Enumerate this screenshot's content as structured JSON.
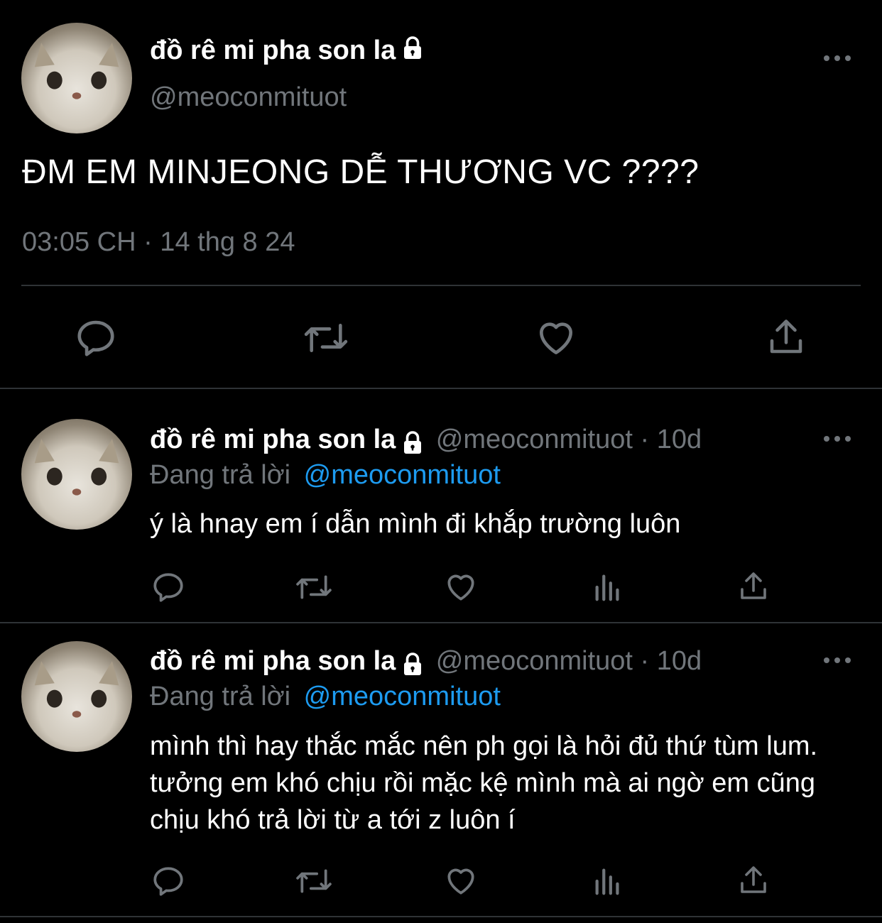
{
  "main_tweet": {
    "display_name": "đồ rê mi pha son la",
    "handle": "@meoconmituot",
    "text": "ĐM EM MINJEONG DỄ THƯƠNG VC ????",
    "timestamp": "03:05 CH · 14 thg 8 24"
  },
  "replies": [
    {
      "display_name": "đồ rê mi pha son la",
      "meta": "@meoconmituot · 10d",
      "replying_prefix": "Đang trả lời",
      "replying_to": "@meoconmituot",
      "text": "ý là hnay em í dẫn mình đi khắp trường luôn"
    },
    {
      "display_name": "đồ rê mi pha son la",
      "meta": "@meoconmituot · 10d",
      "replying_prefix": "Đang trả lời",
      "replying_to": "@meoconmituot",
      "text": "mình thì hay thắc mắc nên ph gọi là hỏi đủ thứ tùm lum. tưởng em khó chịu rồi mặc kệ mình mà ai ngờ em cũng chịu khó trả lời từ a tới z luôn í"
    }
  ],
  "icons": [
    "lock-icon",
    "more-icon",
    "reply-icon",
    "retweet-icon",
    "like-icon",
    "share-icon",
    "views-icon"
  ],
  "colors": {
    "background": "#000000",
    "text": "#ffffff",
    "muted": "#71767b",
    "link": "#1d9bf0",
    "divider": "#2f3336"
  }
}
